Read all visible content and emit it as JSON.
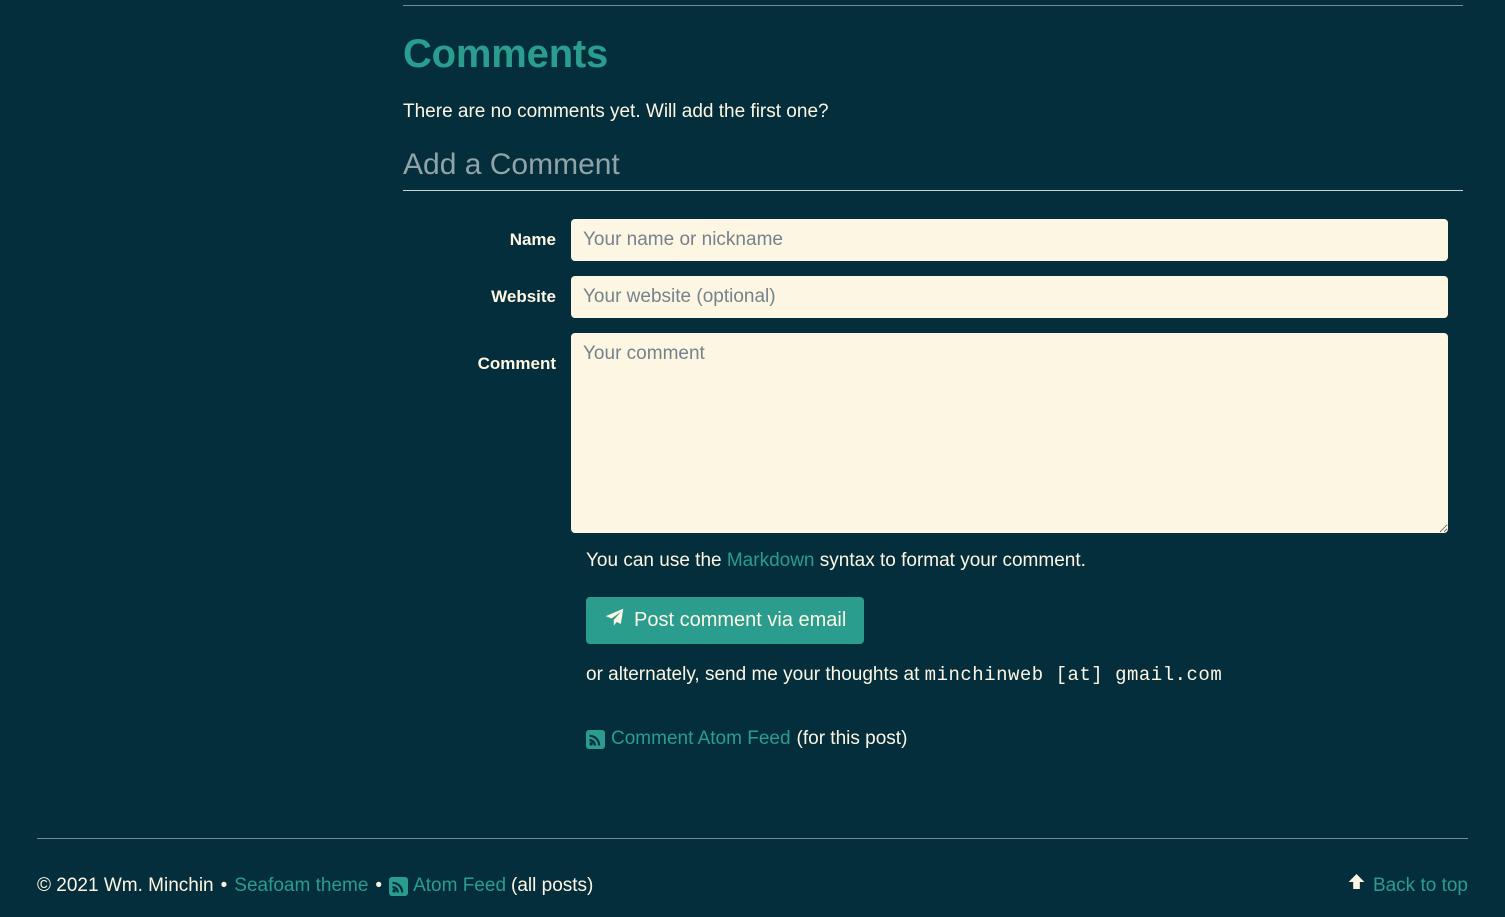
{
  "comments": {
    "heading": "Comments",
    "empty_message": "There are no comments yet. Will add the first one?",
    "add_heading": "Add a Comment"
  },
  "form": {
    "name_label": "Name",
    "name_placeholder": "Your name or nickname",
    "name_value": "",
    "website_label": "Website",
    "website_placeholder": "Your website (optional)",
    "website_value": "",
    "comment_label": "Comment",
    "comment_placeholder": "Your comment",
    "comment_value": "",
    "markdown_note_before": "You can use the ",
    "markdown_link": "Markdown",
    "markdown_note_after": " syntax to format your comment.",
    "submit_label": "Post comment via email",
    "submit_icon": "paper-plane-icon",
    "email_note_before": "or alternately, send me your thoughts at ",
    "email_address": "minchinweb [at] gmail.com"
  },
  "feed": {
    "icon": "rss-icon",
    "link_label": "Comment Atom Feed",
    "suffix": "(for this post)"
  },
  "footer": {
    "copyright": "© 2021 Wm. Minchin",
    "separator": "•",
    "theme_link": "Seafoam theme",
    "feed_icon": "rss-icon",
    "feed_link": "Atom Feed",
    "feed_suffix": "(all posts)",
    "back_to_top": "Back to top",
    "back_to_top_icon": "arrow-up-icon"
  },
  "colors": {
    "background": "#042e3c",
    "accent": "#2a9d8f",
    "text": "#fdf6e3",
    "input_background": "#fdf6e3",
    "placeholder": "#74838c",
    "muted_heading": "#8fa3a8",
    "rule": "#6f8f96"
  }
}
